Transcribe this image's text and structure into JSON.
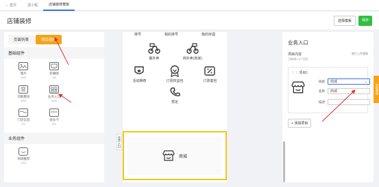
{
  "topbar": {
    "tabs": [
      {
        "label": "首页",
        "icon": "home-icon"
      },
      {
        "label": "选小程"
      },
      {
        "label": "店铺装修模板",
        "active": true
      }
    ]
  },
  "header": {
    "title": "店铺装修",
    "btn_template": "选择模板",
    "btn_save": "保存"
  },
  "left": {
    "tabs": [
      "页面列表",
      "项目组件"
    ],
    "basic_title": "基础组件",
    "basic_items": [
      {
        "label": "图片",
        "count": "5/20"
      },
      {
        "label": "轮播图",
        "count": "0/5"
      },
      {
        "label": "功能模块",
        "count": "8/20"
      },
      {
        "label": "业务入口",
        "count": "2/20"
      },
      {
        "label": "门店信息",
        "count": "0/1"
      },
      {
        "label": "会员卡",
        "count": "0/1"
      }
    ],
    "biz_title": "业务组件",
    "biz_items": [
      {
        "label": "商城推荐",
        "count": "0/10"
      }
    ]
  },
  "center": {
    "top_labels": [
      "排号",
      "我的排号",
      "我的存酒"
    ],
    "row2": [
      "餐外卖",
      "商外卖(商家)"
    ],
    "row3": [
      "活动推荐",
      "订票权益包",
      "订票套包"
    ],
    "row4": [
      "预定"
    ],
    "side_label": "业务入口",
    "selected_label": "商城"
  },
  "right": {
    "title": "业务入口",
    "project_label": "项目内容",
    "project_hint": "图片上传规格",
    "project_sub": "可新增1-4个项目",
    "card_title": "项目1",
    "link_label": "链接",
    "link_value": "商城",
    "name_label": "名称",
    "name_value": "商城",
    "desc_label": "描述",
    "desc_value": "",
    "add_label": "添加项目",
    "side_tab": "视频教程"
  },
  "colors": {
    "accent": "#f7a21b",
    "primary": "#3a6fe8",
    "save": "#2fbf3f",
    "highlight": "#f5c518",
    "arrow": "#e0302b"
  }
}
